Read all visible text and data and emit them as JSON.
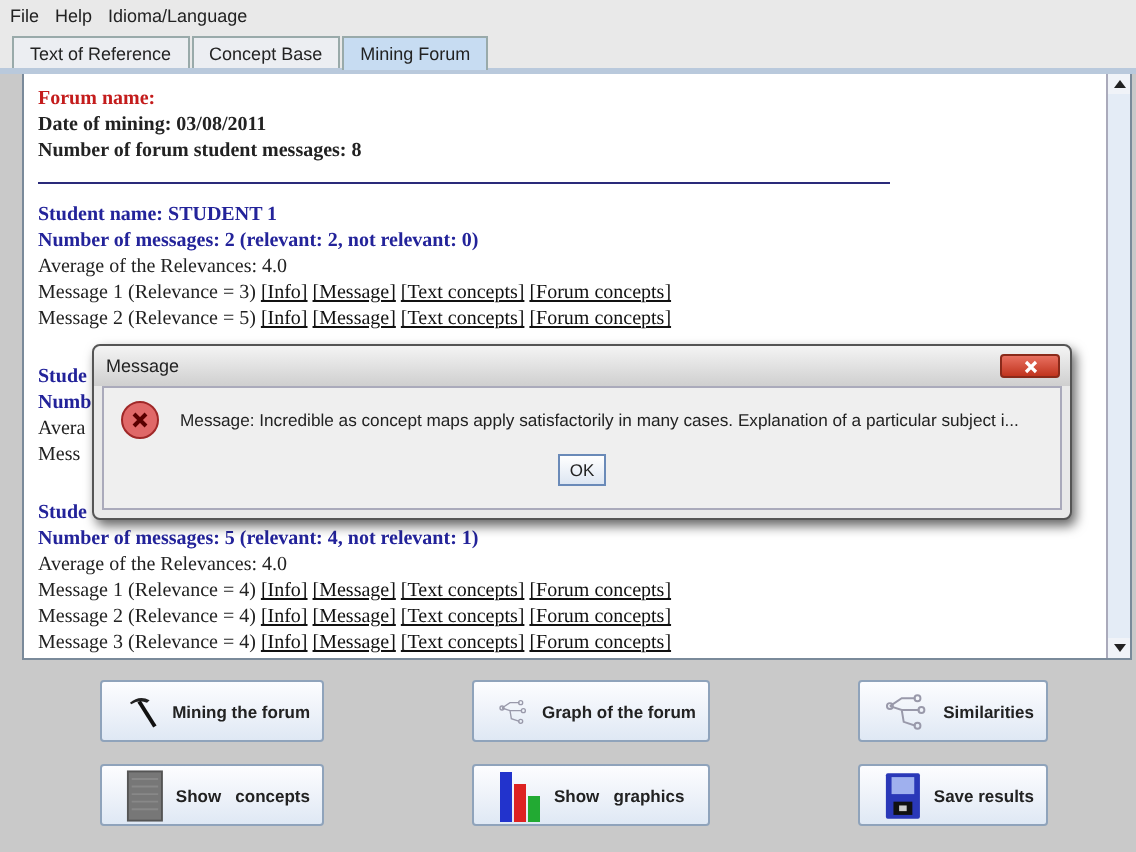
{
  "menu": [
    "File",
    "Help",
    "Idioma/Language"
  ],
  "tabs": [
    {
      "label": "Text of Reference",
      "selected": false
    },
    {
      "label": "Concept Base",
      "selected": false
    },
    {
      "label": "Mining Forum",
      "selected": true
    }
  ],
  "report": {
    "forum_name": "Forum name:",
    "date": "Date of mining: 03/08/2011",
    "count": "Number of forum student messages: 8",
    "students": [
      {
        "name": "Student name: STUDENT 1",
        "summary": "Number of messages: 2 (relevant: 2, not relevant: 0)",
        "average": "Average of the Relevances: 4.0",
        "messages": [
          {
            "text": "Message 1 (Relevance = 3)",
            "links": [
              "[Info]",
              "[Message]",
              "[Text concepts]",
              "[Forum concepts]"
            ]
          },
          {
            "text": "Message 2 (Relevance = 5)",
            "links": [
              "[Info]",
              "[Message]",
              "[Text concepts]",
              "[Forum concepts]"
            ]
          }
        ]
      },
      {
        "name": "Stude",
        "summary": "Numb",
        "average": "Avera",
        "messages": [
          {
            "text": "Mess"
          }
        ]
      },
      {
        "name": "Stude",
        "summary": "Number of messages: 5 (relevant: 4, not relevant: 1)",
        "average": "Average of the Relevances: 4.0",
        "messages": [
          {
            "text": "Message 1 (Relevance = 4)",
            "links": [
              "[Info]",
              "[Message]",
              "[Text concepts]",
              "[Forum concepts]"
            ]
          },
          {
            "text": "Message 2 (Relevance = 4)",
            "links": [
              "[Info]",
              "[Message]",
              "[Text concepts]",
              "[Forum concepts]"
            ]
          },
          {
            "text": "Message 3 (Relevance = 4)",
            "links": [
              "[Info]",
              "[Message]",
              "[Text concepts]",
              "[Forum concepts]"
            ]
          }
        ]
      }
    ]
  },
  "dialog": {
    "title": "Message",
    "text": "Message: Incredible as concept maps apply satisfactorily in many cases. Explanation of a particular subject i...",
    "button": "OK"
  },
  "buttons": [
    {
      "label": "Mining the forum",
      "kind": "pickaxe"
    },
    {
      "label": "Graph of the forum",
      "kind": "graph"
    },
    {
      "label": "Similarities",
      "kind": "graph"
    },
    {
      "label": "Show   concepts",
      "kind": "book"
    },
    {
      "label": "Show   graphics",
      "kind": "bars"
    },
    {
      "label": "Save results",
      "kind": "floppy"
    }
  ]
}
